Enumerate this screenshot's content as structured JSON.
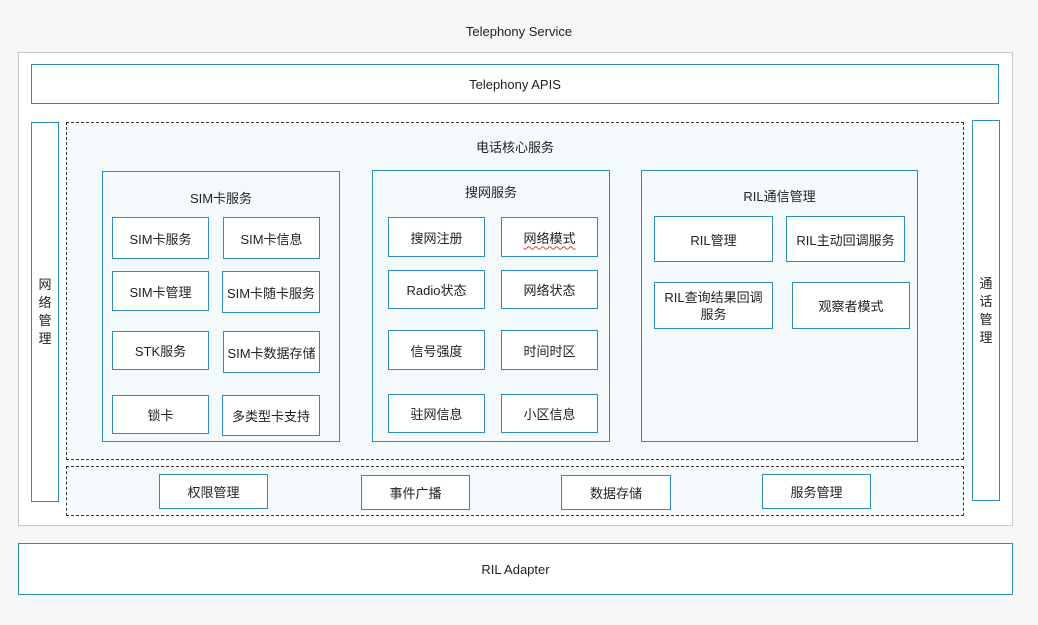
{
  "service_title": "Telephony Service",
  "apis": "Telephony APIS",
  "left_vertical": "网络管理",
  "right_vertical": "通话管理",
  "core_title": "电话核心服务",
  "sim": {
    "title": "SIM卡服务",
    "items": [
      "SIM卡服务",
      "SIM卡信息",
      "SIM卡管理",
      "SIM卡随卡服务",
      "STK服务",
      "SIM卡数据存储",
      "锁卡",
      "多类型卡支持"
    ]
  },
  "search": {
    "title": "搜网服务",
    "items": [
      "搜网注册",
      "网络模式",
      "Radio状态",
      "网络状态",
      "信号强度",
      "时间时区",
      "驻网信息",
      "小区信息"
    ]
  },
  "ril": {
    "title": "RIL通信管理",
    "items": [
      "RIL管理",
      "RIL主动回调服务",
      "RIL查询结果回调服务",
      "观察者模式"
    ]
  },
  "bottom_items": [
    "权限管理",
    "事件广播",
    "数据存储",
    "服务管理"
  ],
  "adapter": "RIL Adapter"
}
